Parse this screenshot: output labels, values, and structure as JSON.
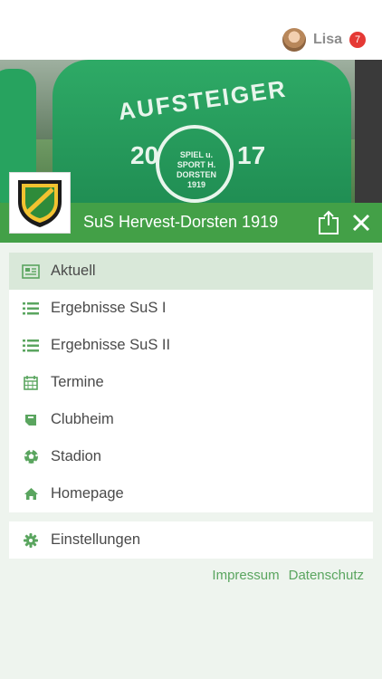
{
  "header": {
    "user_name": "Lisa",
    "notification_count": "7"
  },
  "hero": {
    "shirt_text": "AUFSTEIGER",
    "year_left": "20",
    "year_right": "17",
    "crest_text": "SPIEL u. SPORT H. DORSTEN 1919"
  },
  "club": {
    "name": "SuS Hervest-Dorsten 1919",
    "logo_text": "SPIEL u. SPORT H. DORSTEN 1919"
  },
  "menu": {
    "items": [
      {
        "label": "Aktuell",
        "icon": "newspaper-icon",
        "active": true
      },
      {
        "label": "Ergebnisse SuS I",
        "icon": "list-icon",
        "active": false
      },
      {
        "label": "Ergebnisse SuS II",
        "icon": "list-icon",
        "active": false
      },
      {
        "label": "Termine",
        "icon": "calendar-icon",
        "active": false
      },
      {
        "label": "Clubheim",
        "icon": "ticket-icon",
        "active": false
      },
      {
        "label": "Stadion",
        "icon": "soccer-ball-icon",
        "active": false
      },
      {
        "label": "Homepage",
        "icon": "home-icon",
        "active": false
      }
    ],
    "settings_label": "Einstellungen"
  },
  "footer": {
    "impressum": "Impressum",
    "datenschutz": "Datenschutz"
  },
  "colors": {
    "accent": "#43a047",
    "icon": "#5aa55f",
    "active_bg": "#d9e8d9",
    "badge": "#e53935",
    "page_bg": "#eef4ee"
  }
}
